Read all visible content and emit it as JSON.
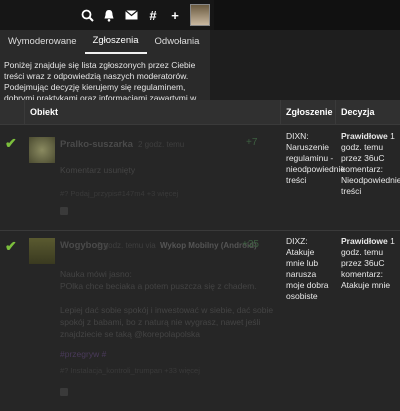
{
  "topbar": {
    "icons": [
      "search-icon",
      "bell-icon",
      "mail-icon",
      "hashtag-icon",
      "plus-icon"
    ],
    "icon_glyphs": {
      "search": "⚲",
      "bell": "🔔",
      "mail": "✉",
      "hash": "#",
      "plus": "+"
    }
  },
  "tabs": [
    {
      "label": "Wymoderowane"
    },
    {
      "label": "Zgłoszenia"
    },
    {
      "label": "Odwołania"
    }
  ],
  "notice": "Poniżej znajduje się lista zgłoszonych przez Ciebie treści wraz z odpowiedzią naszych moderatorów. Podejmując decyzję kierujemy się regulaminem, dobrymi praktykami oraz informacjami zawartymi w FAQ.",
  "table": {
    "headers": {
      "object": "Obiekt",
      "report": "Zgłoszenie",
      "decision": "Decyzja"
    },
    "rows": [
      {
        "author": "Pralko-suszarka",
        "time": "2 godz. temu",
        "votes": "+7",
        "body": "Komentarz usunięty",
        "tags": "#? Podaj_przypis#147m4 +3 więcej",
        "report": "DIXN: Naruszenie regulaminu - nieodpowiednie treści",
        "decision_strong": "Prawidłowe",
        "decision_text": "1 godz. temu przez 36uC komentarz: Nieodpowiednie treści"
      },
      {
        "author": "Wogybogy",
        "time": "2 godz. temu via",
        "app": "Wykop Mobilny (Android)",
        "votes": "+35",
        "body_lines": [
          "Nauka mówi jasno:",
          "POlka chce beciaka a potem puszcza się z chadem.",
          "",
          "Lepiej dać sobie spokój i inwestować w siebie, dać sobie",
          "spokój z babami, bo z naturą nie wygrasz, nawet jeśli",
          "znajdziecie se taką @korepolapolska"
        ],
        "tag": "#przegryw #",
        "tags": "#? Instalacja_kontroli_trumpan +33 więcej",
        "report": "DIXZ: Atakuje mnie lub narusza moje dobra osobiste",
        "decision_strong": "Prawidłowe",
        "decision_text": "1 godz. temu przez 36uC komentarz: Atakuje mnie"
      }
    ]
  }
}
